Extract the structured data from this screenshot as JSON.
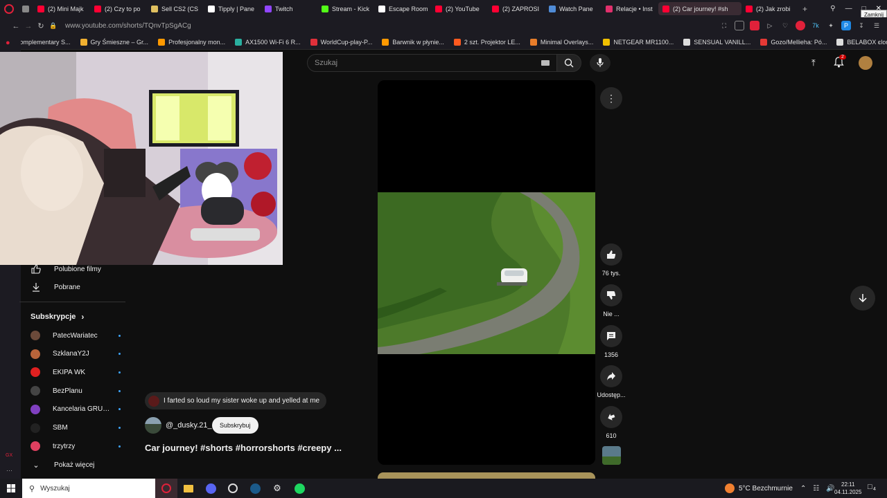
{
  "tabs": [
    {
      "label": "",
      "color": "#888888"
    },
    {
      "label": "(2) Mini Majk",
      "color": "#ff0033"
    },
    {
      "label": "(2) Czy to po",
      "color": "#ff0033"
    },
    {
      "label": "Sell CS2 (CS",
      "color": "#e0c060"
    },
    {
      "label": "Tipply | Pane",
      "color": "#ffffff"
    },
    {
      "label": "Twitch",
      "color": "#9146ff"
    },
    {
      "label": "Stream - Kick",
      "color": "#53fc18"
    },
    {
      "label": "Escape Room",
      "color": "#ffffff"
    },
    {
      "label": "(2) YouTube",
      "color": "#ff0033"
    },
    {
      "label": "(2) ZAPROSI",
      "color": "#ff0033"
    },
    {
      "label": "Watch Pane",
      "color": "#4f8bd6"
    },
    {
      "label": "Relacje • Inst",
      "color": "#e1306c"
    },
    {
      "label": "(2) Car journey! #sh",
      "color": "#ff0033",
      "active": true
    },
    {
      "label": "(2) Jak zrobi",
      "color": "#ff0033"
    }
  ],
  "close_tooltip": "Zamknij",
  "address": {
    "url": "www.youtube.com/shorts/TQnvTpSgACg"
  },
  "bookmarks": [
    {
      "label": "Complementary S...",
      "color": "#d89a3a"
    },
    {
      "label": "Gry Śmieszne – Gr...",
      "color": "#f0b030"
    },
    {
      "label": "Profesjonalny mon...",
      "color": "#ff9900"
    },
    {
      "label": "AX1500 Wi-Fi 6 R...",
      "color": "#2ab0a0"
    },
    {
      "label": "WorldCup-play-P...",
      "color": "#e0303a"
    },
    {
      "label": "Barwnik w płynie...",
      "color": "#ff9900"
    },
    {
      "label": "2 szt. Projektor LE...",
      "color": "#ff5a1f"
    },
    {
      "label": "Minimal Overlays...",
      "color": "#e87d2a"
    },
    {
      "label": "NETGEAR MR1100...",
      "color": "#f0c000"
    },
    {
      "label": "SENSUAL VANILL...",
      "color": "#dddddd"
    },
    {
      "label": "Gozo/Mellieha: Pó...",
      "color": "#e53935"
    },
    {
      "label": "BELABOX cloud",
      "color": "#dddddd"
    }
  ],
  "search": {
    "placeholder": "Szukaj"
  },
  "notifications_count": "2",
  "sidebar": {
    "liked": "Polubione filmy",
    "downloads": "Pobrane",
    "subs_title": "Subskrypcje",
    "subs": [
      {
        "label": "PatecWariatec",
        "color": "#6b4a3a"
      },
      {
        "label": "SzklanaY2J",
        "color": "#b8643a"
      },
      {
        "label": "EKIPA WK",
        "color": "#e02020"
      },
      {
        "label": "BezPlanu",
        "color": "#444444"
      },
      {
        "label": "Kancelaria GRUB...",
        "color": "#8040c0"
      },
      {
        "label": "SBM",
        "color": "#222222"
      },
      {
        "label": "trzytrzy",
        "color": "#e04060"
      }
    ],
    "show_more": "Pokaż więcej"
  },
  "video": {
    "comment_preview": "I farted so loud my sister woke up and yelled at me",
    "channel": "@_dusky.21_",
    "subscribe": "Subskrybuj",
    "title": "Car journey! #shorts #horrorshorts #creepy ..."
  },
  "actions": {
    "likes": "76 tys.",
    "dislike": "Nie ...",
    "comments": "1356",
    "share": "Udostęp...",
    "remix": "610"
  },
  "taskbar": {
    "search": "Wyszukaj",
    "weather": "5°C  Bezchmurnie",
    "time": "22:11",
    "date": "04.11.2025",
    "notif": "4"
  }
}
